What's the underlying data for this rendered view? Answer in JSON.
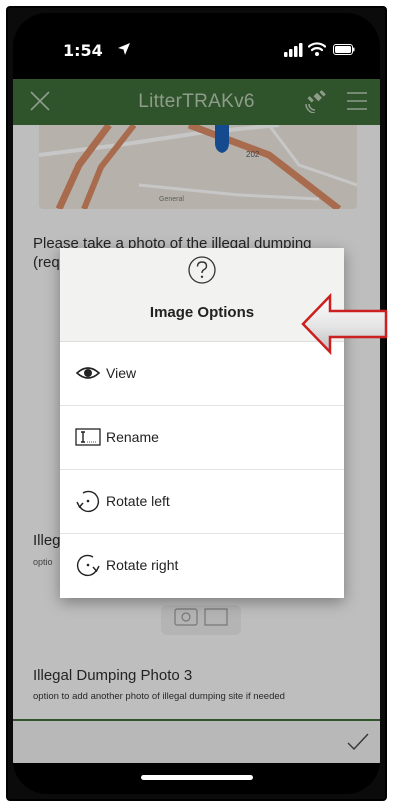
{
  "status_bar": {
    "time": "1:54"
  },
  "app_bar": {
    "title": "LitterTRAKv6"
  },
  "map": {
    "labels": [
      "202",
      "General"
    ]
  },
  "form": {
    "question1_text": "Please take a photo of the illegal dumping (required)",
    "required_mark": "*",
    "question2_text": "Illeg",
    "question2_sub": "optio",
    "question3_text": "Illegal Dumping Photo 3",
    "question3_sub": "option to add another photo of illegal dumping site if needed"
  },
  "dialog": {
    "title": "Image Options",
    "options": [
      {
        "label": "View",
        "icon": "eye-icon"
      },
      {
        "label": "Rename",
        "icon": "rename-icon"
      },
      {
        "label": "Rotate left",
        "icon": "rotate-left-icon"
      },
      {
        "label": "Rotate right",
        "icon": "rotate-right-icon"
      }
    ]
  },
  "colors": {
    "app_bar": "#3d6b36",
    "annotation_arrow": "#cc1f1f"
  }
}
